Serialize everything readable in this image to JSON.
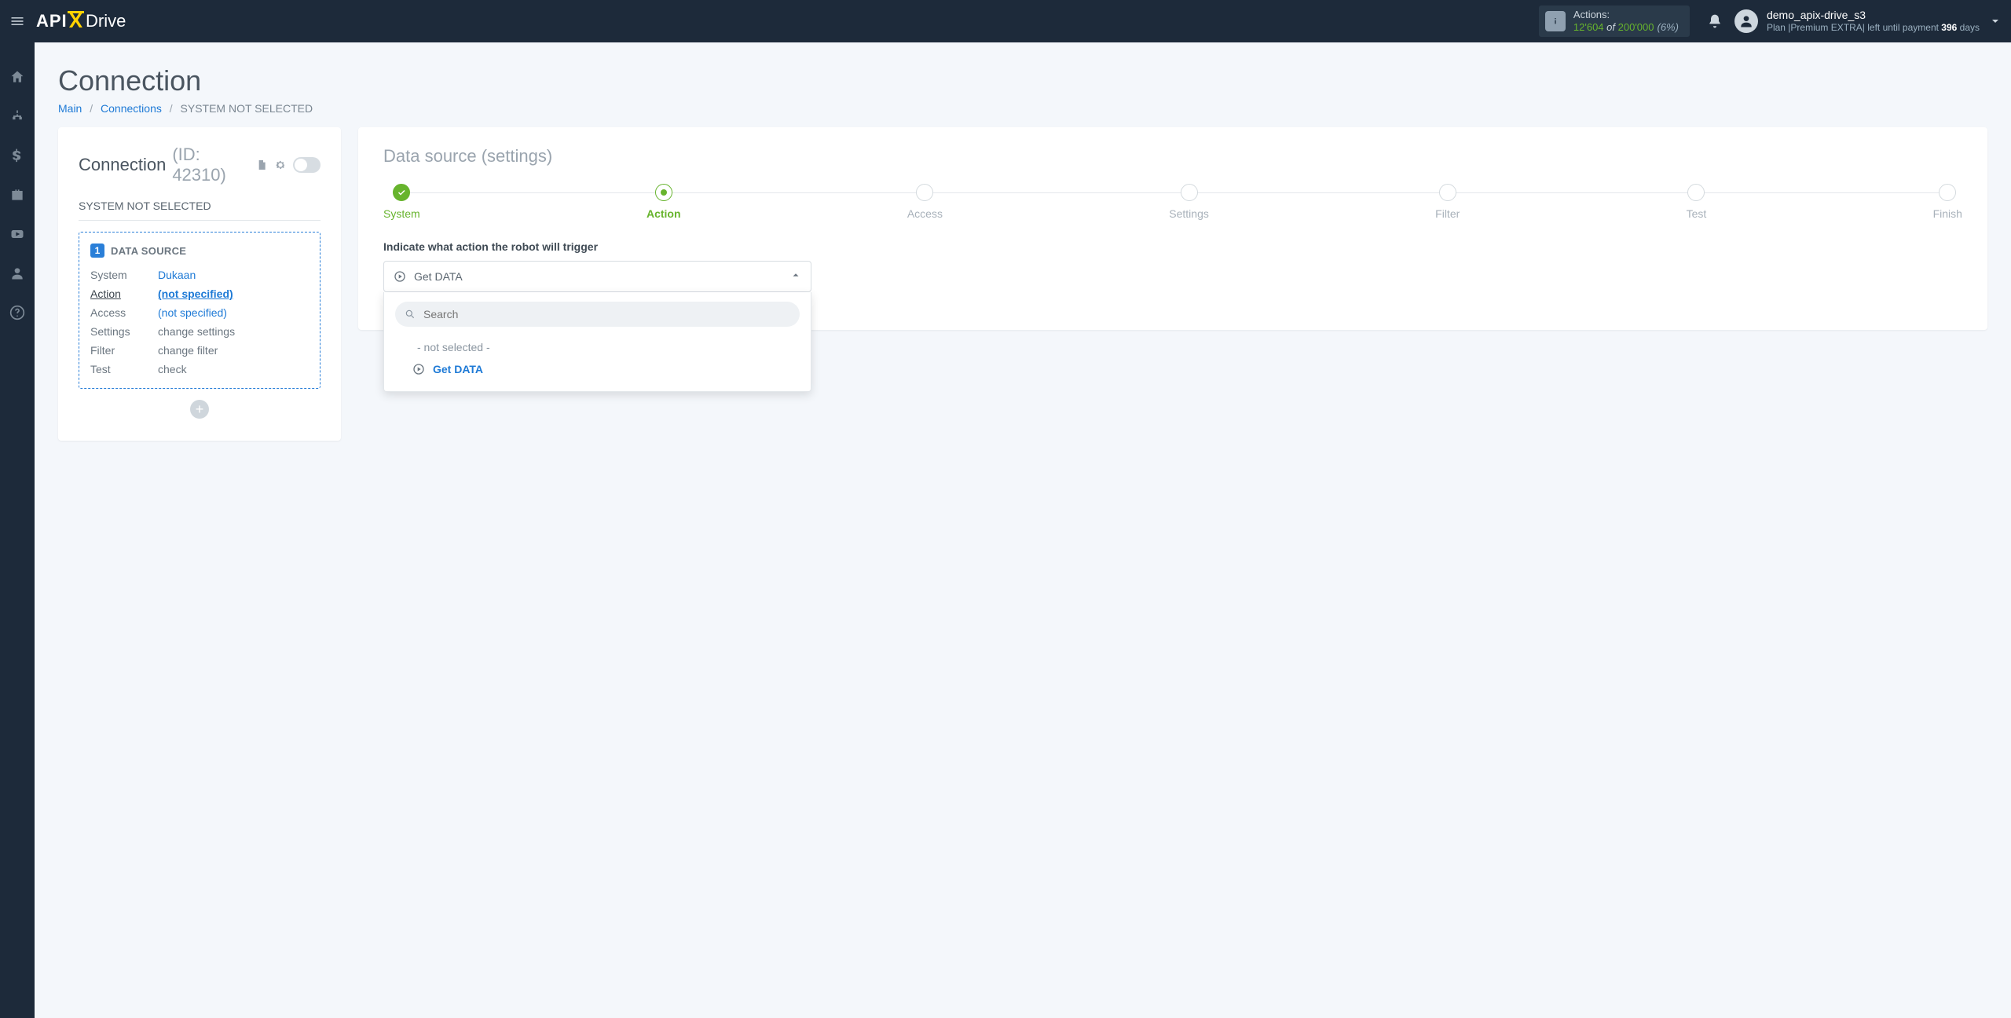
{
  "header": {
    "logo_api": "API",
    "logo_x": "X",
    "logo_drive": "Drive",
    "actions_label": "Actions:",
    "actions_used": "12'604",
    "actions_of": " of ",
    "actions_total": "200'000",
    "actions_pct": "(6%)",
    "user_name": "demo_apix-drive_s3",
    "plan_prefix": "Plan |",
    "plan_name": "Premium EXTRA",
    "plan_mid": "| left until payment ",
    "plan_days": "396",
    "plan_suffix": " days"
  },
  "rail": [
    "home",
    "sitemap",
    "dollar",
    "briefcase",
    "youtube",
    "user",
    "help"
  ],
  "page": {
    "title": "Connection",
    "crumb_main": "Main",
    "crumb_connections": "Connections",
    "crumb_current": "SYSTEM NOT SELECTED"
  },
  "conn": {
    "heading": "Connection",
    "id_label": "(ID: 42310)",
    "subtitle": "SYSTEM NOT SELECTED",
    "ds_label": "DATA SOURCE",
    "rows": {
      "system_k": "System",
      "system_v": "Dukaan",
      "action_k": "Action",
      "action_v": "(not specified)",
      "access_k": "Access",
      "access_v": "(not specified)",
      "settings_k": "Settings",
      "settings_v": "change settings",
      "filter_k": "Filter",
      "filter_v": "change filter",
      "test_k": "Test",
      "test_v": "check"
    }
  },
  "right": {
    "title_main": "Data source ",
    "title_sub": "(settings)",
    "steps": [
      "System",
      "Action",
      "Access",
      "Settings",
      "Filter",
      "Test",
      "Finish"
    ],
    "instruction": "Indicate what action the robot will trigger",
    "selected": "Get DATA",
    "search_placeholder": "Search",
    "opt_none": "- not selected -",
    "opt_get": "Get DATA"
  }
}
